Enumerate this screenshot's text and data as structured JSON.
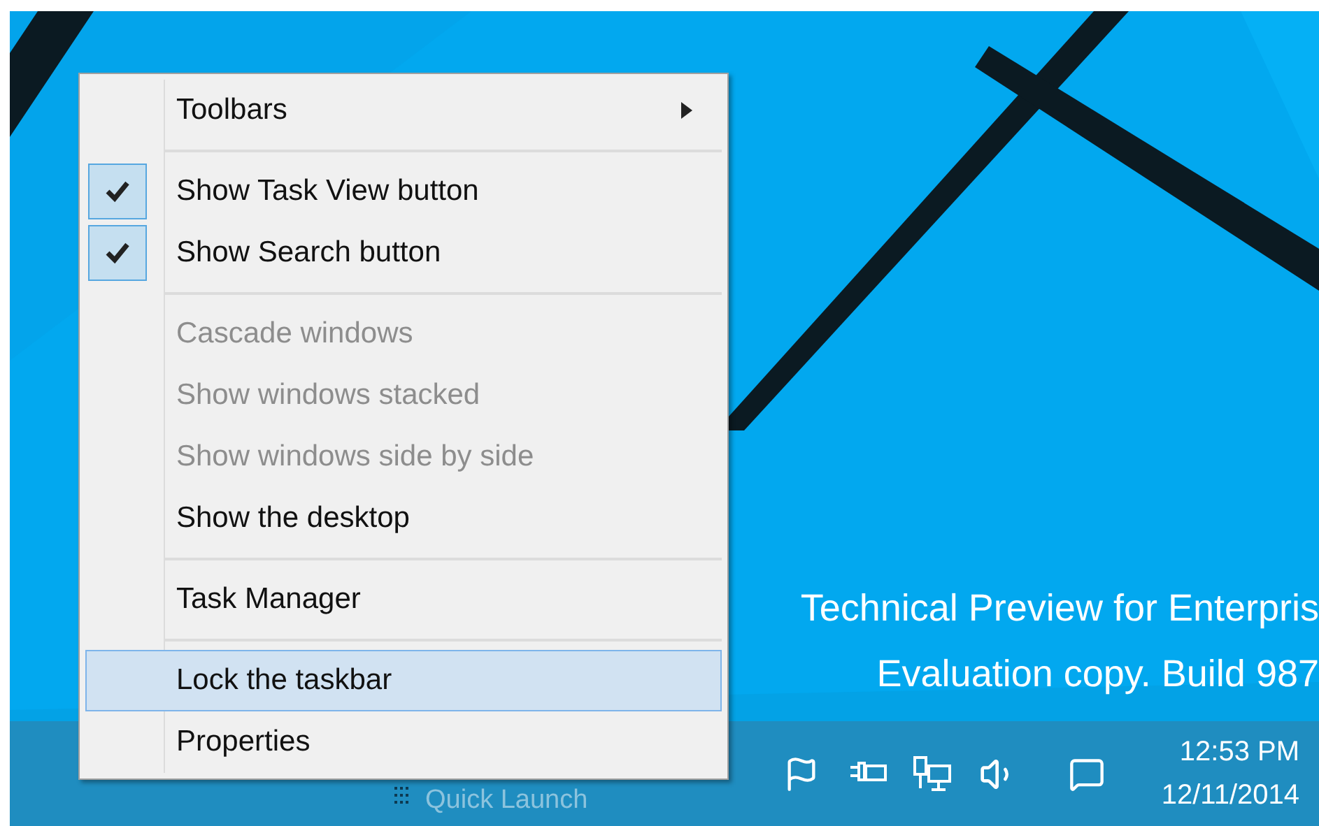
{
  "desktop": {
    "watermark": [
      "Technical Preview for Enterpris",
      "Evaluation copy. Build 987"
    ]
  },
  "context_menu": {
    "items": [
      {
        "kind": "item",
        "label": "Toolbars",
        "submenu": true,
        "checked": false,
        "disabled": false,
        "selected": false
      },
      {
        "kind": "separator"
      },
      {
        "kind": "item",
        "label": "Show Task View button",
        "submenu": false,
        "checked": true,
        "disabled": false,
        "selected": false
      },
      {
        "kind": "item",
        "label": "Show Search button",
        "submenu": false,
        "checked": true,
        "disabled": false,
        "selected": false
      },
      {
        "kind": "separator"
      },
      {
        "kind": "item",
        "label": "Cascade windows",
        "submenu": false,
        "checked": false,
        "disabled": true,
        "selected": false
      },
      {
        "kind": "item",
        "label": "Show windows stacked",
        "submenu": false,
        "checked": false,
        "disabled": true,
        "selected": false
      },
      {
        "kind": "item",
        "label": "Show windows side by side",
        "submenu": false,
        "checked": false,
        "disabled": true,
        "selected": false
      },
      {
        "kind": "item",
        "label": "Show the desktop",
        "submenu": false,
        "checked": false,
        "disabled": false,
        "selected": false
      },
      {
        "kind": "separator"
      },
      {
        "kind": "item",
        "label": "Task Manager",
        "submenu": false,
        "checked": false,
        "disabled": false,
        "selected": false
      },
      {
        "kind": "separator"
      },
      {
        "kind": "item",
        "label": "Lock the taskbar",
        "submenu": false,
        "checked": false,
        "disabled": false,
        "selected": true
      },
      {
        "kind": "item",
        "label": "Properties",
        "submenu": false,
        "checked": false,
        "disabled": false,
        "selected": false
      }
    ]
  },
  "taskbar": {
    "toolbar_label": "Quick Launch",
    "clock": {
      "time": "12:53 PM",
      "date": "12/11/2014"
    }
  }
}
